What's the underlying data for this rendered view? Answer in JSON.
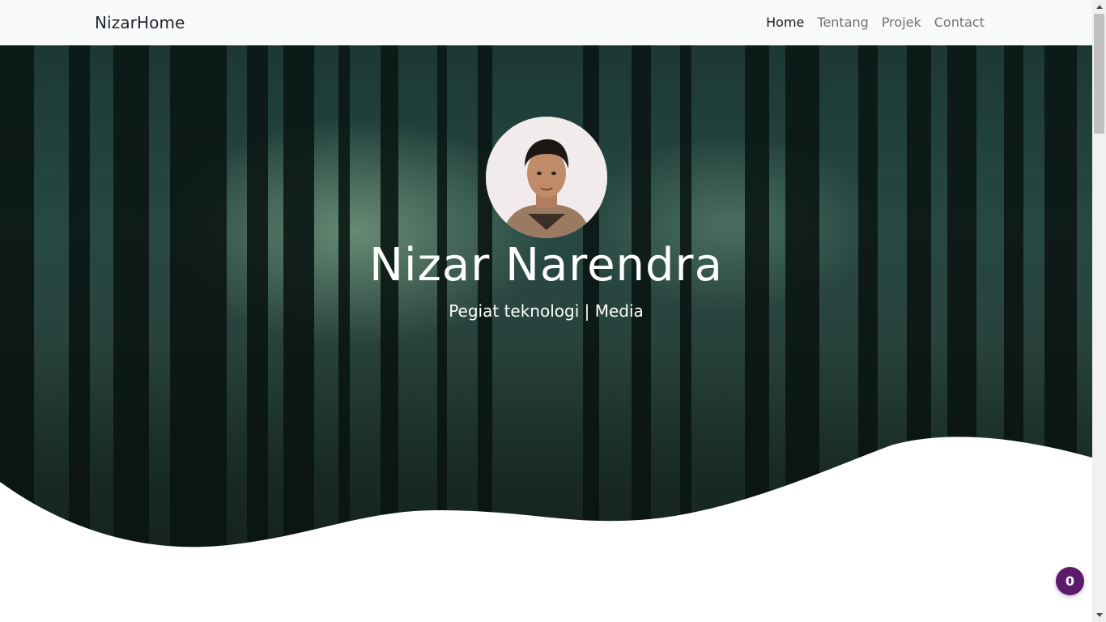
{
  "navbar": {
    "brand": "NizarHome",
    "links": [
      {
        "label": "Home",
        "active": true
      },
      {
        "label": "Tentang",
        "active": false
      },
      {
        "label": "Projek",
        "active": false
      },
      {
        "label": "Contact",
        "active": false
      }
    ]
  },
  "hero": {
    "title": "Nizar Narendra",
    "subtitle": "Pegiat teknologi | Media",
    "avatar_icon": "profile-photo"
  },
  "badge": {
    "count": "0"
  },
  "colors": {
    "navbar_bg": "#f8f9fa",
    "badge_bg": "#5c1a6b",
    "hero_tint": "#2b4f49"
  }
}
